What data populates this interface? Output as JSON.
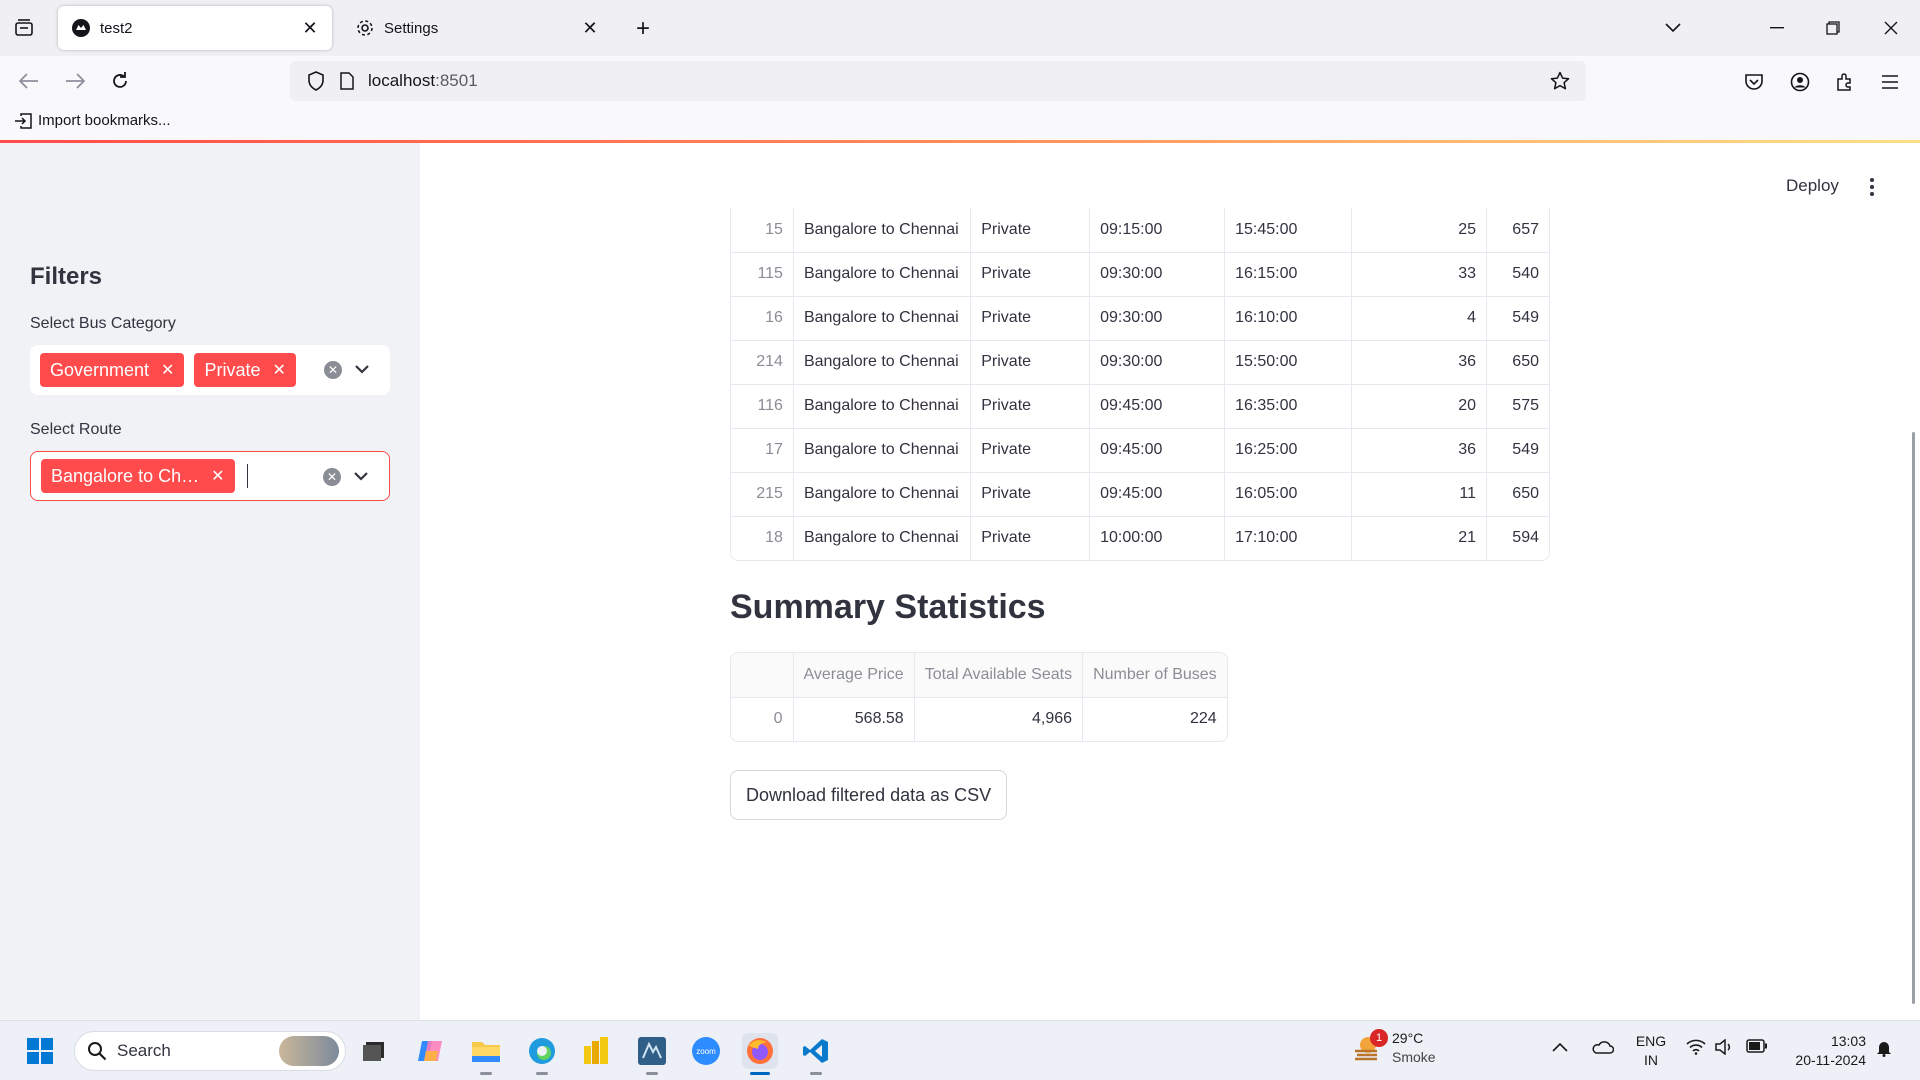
{
  "browser": {
    "tabs": [
      {
        "title": "test2",
        "active": true
      },
      {
        "title": "Settings",
        "active": false
      }
    ],
    "url_host": "localhost",
    "url_port": ":8501",
    "bookmark_label": "Import bookmarks..."
  },
  "app": {
    "deploy_label": "Deploy",
    "sidebar": {
      "title": "Filters",
      "bus_category_label": "Select Bus Category",
      "bus_category_chips": [
        "Government",
        "Private"
      ],
      "route_label": "Select Route",
      "route_chips": [
        "Bangalore to Ch…"
      ]
    },
    "data_rows": [
      {
        "idx": "15",
        "route": "Bangalore to Chennai",
        "type": "Private",
        "dep": "09:15:00",
        "arr": "15:45:00",
        "seats": "25",
        "price": "657"
      },
      {
        "idx": "115",
        "route": "Bangalore to Chennai",
        "type": "Private",
        "dep": "09:30:00",
        "arr": "16:15:00",
        "seats": "33",
        "price": "540"
      },
      {
        "idx": "16",
        "route": "Bangalore to Chennai",
        "type": "Private",
        "dep": "09:30:00",
        "arr": "16:10:00",
        "seats": "4",
        "price": "549"
      },
      {
        "idx": "214",
        "route": "Bangalore to Chennai",
        "type": "Private",
        "dep": "09:30:00",
        "arr": "15:50:00",
        "seats": "36",
        "price": "650"
      },
      {
        "idx": "116",
        "route": "Bangalore to Chennai",
        "type": "Private",
        "dep": "09:45:00",
        "arr": "16:35:00",
        "seats": "20",
        "price": "575"
      },
      {
        "idx": "17",
        "route": "Bangalore to Chennai",
        "type": "Private",
        "dep": "09:45:00",
        "arr": "16:25:00",
        "seats": "36",
        "price": "549"
      },
      {
        "idx": "215",
        "route": "Bangalore to Chennai",
        "type": "Private",
        "dep": "09:45:00",
        "arr": "16:05:00",
        "seats": "11",
        "price": "650"
      },
      {
        "idx": "18",
        "route": "Bangalore to Chennai",
        "type": "Private",
        "dep": "10:00:00",
        "arr": "17:10:00",
        "seats": "21",
        "price": "594"
      }
    ],
    "summary": {
      "heading": "Summary Statistics",
      "headers": [
        "",
        "Average Price",
        "Total Available Seats",
        "Number of Buses"
      ],
      "row": [
        "0",
        "568.58",
        "4,966",
        "224"
      ]
    },
    "download_label": "Download filtered data as CSV"
  },
  "taskbar": {
    "search_label": "Search",
    "weather_temp": "29°C",
    "weather_desc": "Smoke",
    "weather_badge": "1",
    "lang_top": "ENG",
    "lang_bottom": "IN",
    "time": "13:03",
    "date": "20-11-2024"
  },
  "colors": {
    "accent": "#ff4b4b",
    "sidebar_bg": "#f0f2f6",
    "text": "#31333f"
  }
}
